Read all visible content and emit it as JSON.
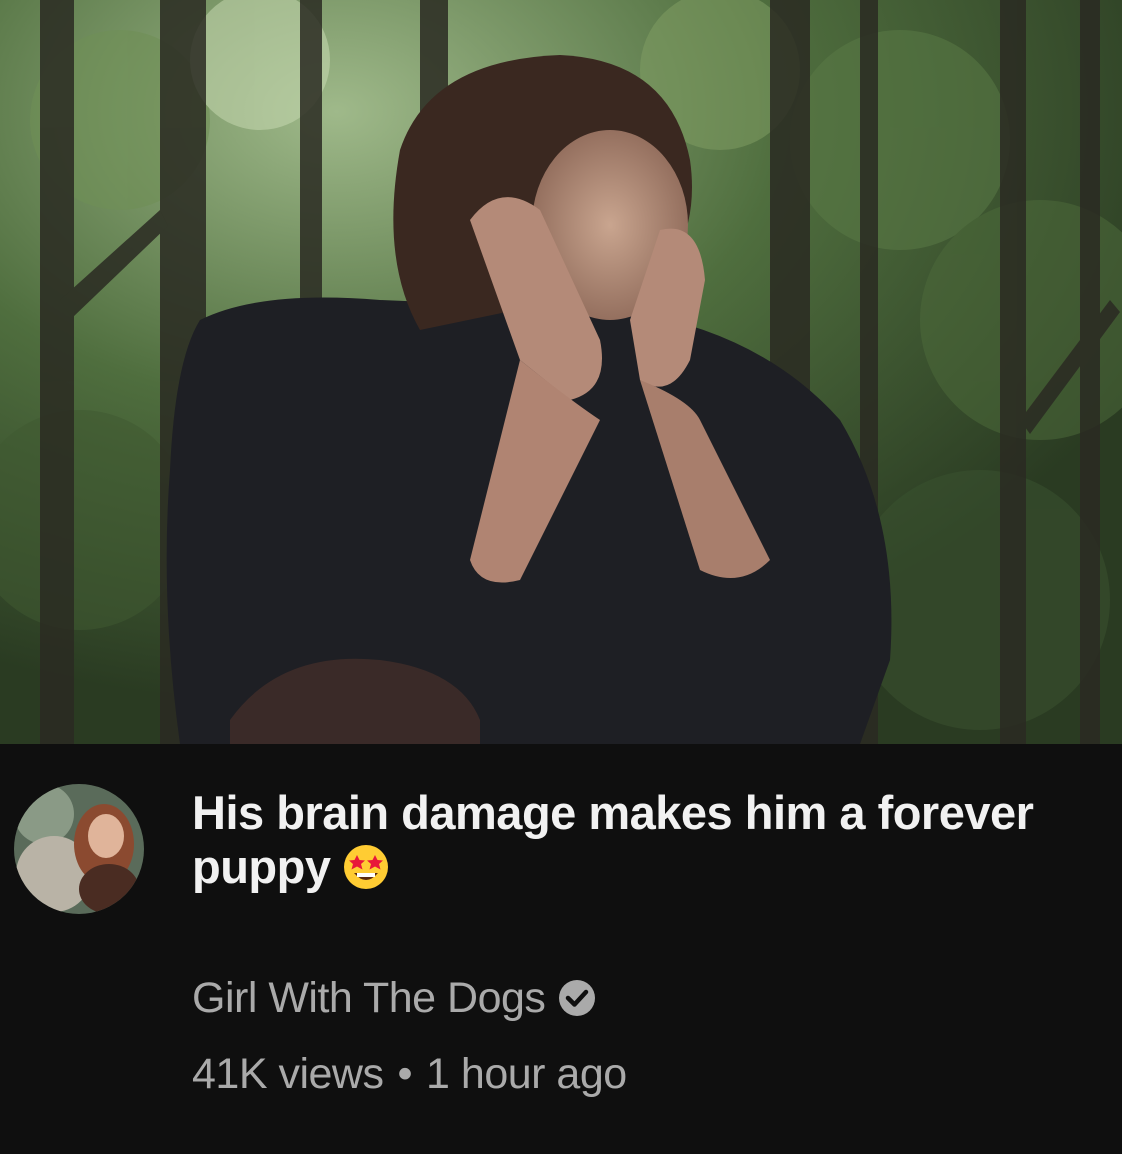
{
  "video": {
    "title": "His brain damage makes him a forever puppy",
    "title_emoji": "star-struck-emoji",
    "thumbnail": "forest-man-resting-chin-on-hands",
    "channel": "Girl With The Dogs",
    "channel_verified": true,
    "views": "41K views",
    "separator": "•",
    "age": "1 hour ago"
  },
  "colors": {
    "background": "#0f0f0f",
    "title": "#f1f1f1",
    "meta": "#aaaaaa"
  }
}
